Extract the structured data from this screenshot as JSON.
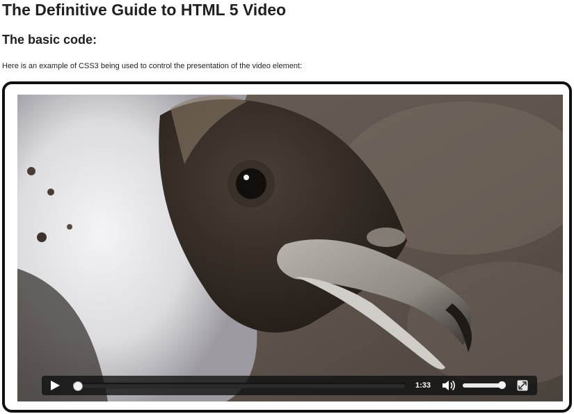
{
  "page": {
    "title": "The Definitive Guide to HTML 5 Video",
    "section_heading": "The basic code:",
    "intro": "Here is an example of CSS3 being used to control the presentation of the video element:"
  },
  "player": {
    "time": "1:33",
    "progress": 0.01,
    "volume": 0.98,
    "icons": {
      "play": "play-icon",
      "mute": "speaker-icon",
      "fullscreen": "fullscreen-icon"
    }
  }
}
